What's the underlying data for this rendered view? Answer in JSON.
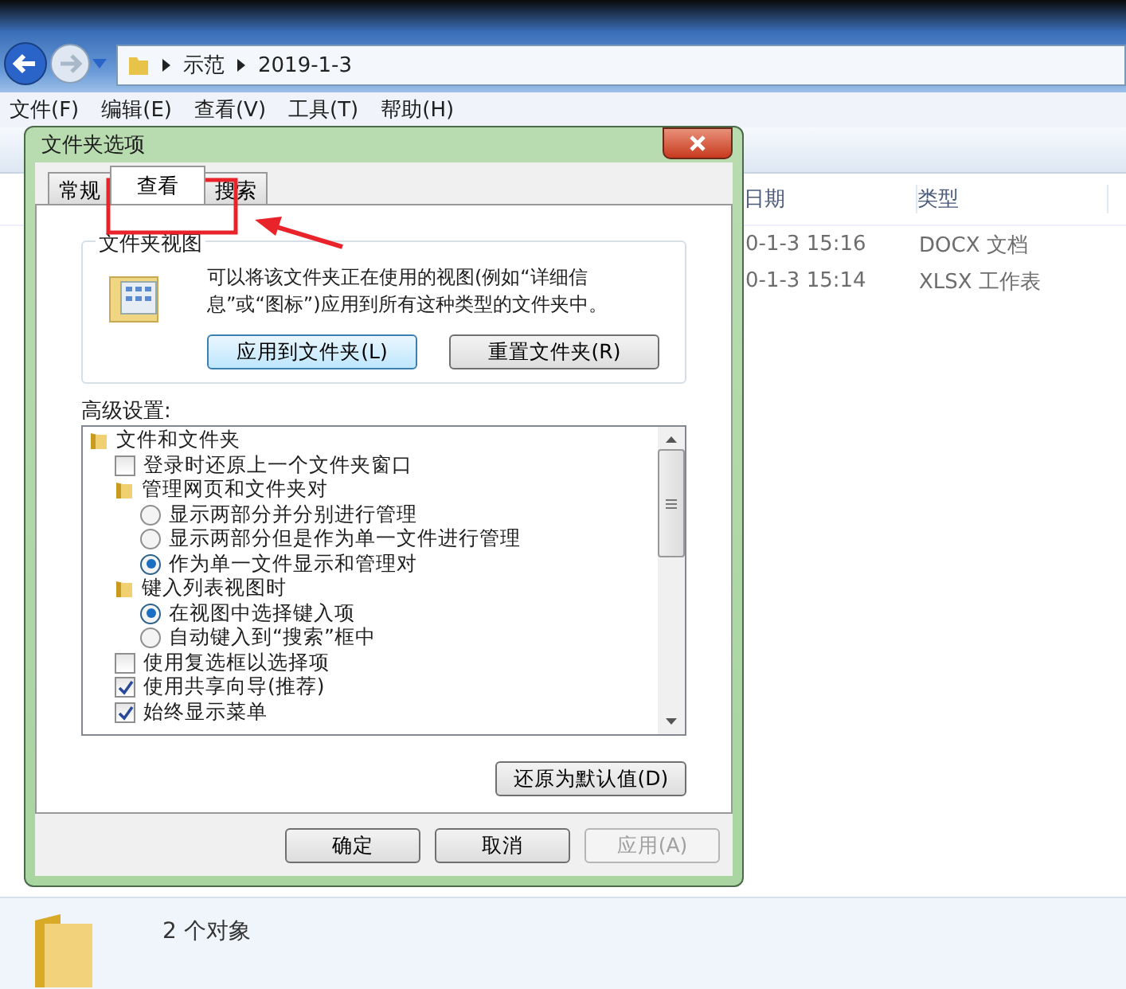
{
  "explorer": {
    "breadcrumb": [
      "示范",
      "2019-1-3"
    ],
    "menu": [
      "文件(F)",
      "编辑(E)",
      "查看(V)",
      "工具(T)",
      "帮助(H)"
    ],
    "columns": [
      "日期",
      "类型"
    ],
    "rows": [
      [
        "0-1-3 15:16",
        "DOCX 文档"
      ],
      [
        "0-1-3 15:14",
        "XLSX 工作表"
      ]
    ],
    "status": "2 个对象"
  },
  "dialog": {
    "title": "文件夹选项",
    "tabs": [
      {
        "label": "常规",
        "selected": false
      },
      {
        "label": "查看",
        "selected": true
      },
      {
        "label": "搜索",
        "selected": false
      }
    ],
    "folder_views": {
      "title": "文件夹视图",
      "description": "可以将该文件夹正在使用的视图(例如“详细信息”或“图标”)应用到所有这种类型的文件夹中。",
      "buttons": [
        {
          "label": "应用到文件夹(L)",
          "default": true
        },
        {
          "label": "重置文件夹(R)",
          "default": false
        }
      ]
    },
    "advanced": {
      "label": "高级设置:",
      "items": [
        {
          "kind": "folder",
          "label": "文件和文件夹",
          "children": [
            {
              "kind": "checkbox",
              "label": "登录时还原上一个文件夹窗口",
              "checked": false
            },
            {
              "kind": "folder",
              "label": "管理网页和文件夹对",
              "children": [
                {
                  "kind": "radio",
                  "label": "显示两部分并分别进行管理",
                  "selected": false
                },
                {
                  "kind": "radio",
                  "label": "显示两部分但是作为单一文件进行管理",
                  "selected": false
                },
                {
                  "kind": "radio",
                  "label": "作为单一文件显示和管理对",
                  "selected": true
                }
              ]
            },
            {
              "kind": "folder",
              "label": "键入列表视图时",
              "children": [
                {
                  "kind": "radio",
                  "label": "在视图中选择键入项",
                  "selected": true
                },
                {
                  "kind": "radio",
                  "label": "自动键入到“搜索”框中",
                  "selected": false
                }
              ]
            },
            {
              "kind": "checkbox",
              "label": "使用复选框以选择项",
              "checked": false
            },
            {
              "kind": "checkbox",
              "label": "使用共享向导(推荐)",
              "checked": true
            },
            {
              "kind": "checkbox",
              "label": "始终显示菜单",
              "checked": true
            }
          ]
        }
      ]
    },
    "restore_button": "还原为默认值(D)",
    "footer_buttons": [
      {
        "label": "确定",
        "disabled": false
      },
      {
        "label": "取消",
        "disabled": false
      },
      {
        "label": "应用(A)",
        "disabled": true
      }
    ]
  }
}
